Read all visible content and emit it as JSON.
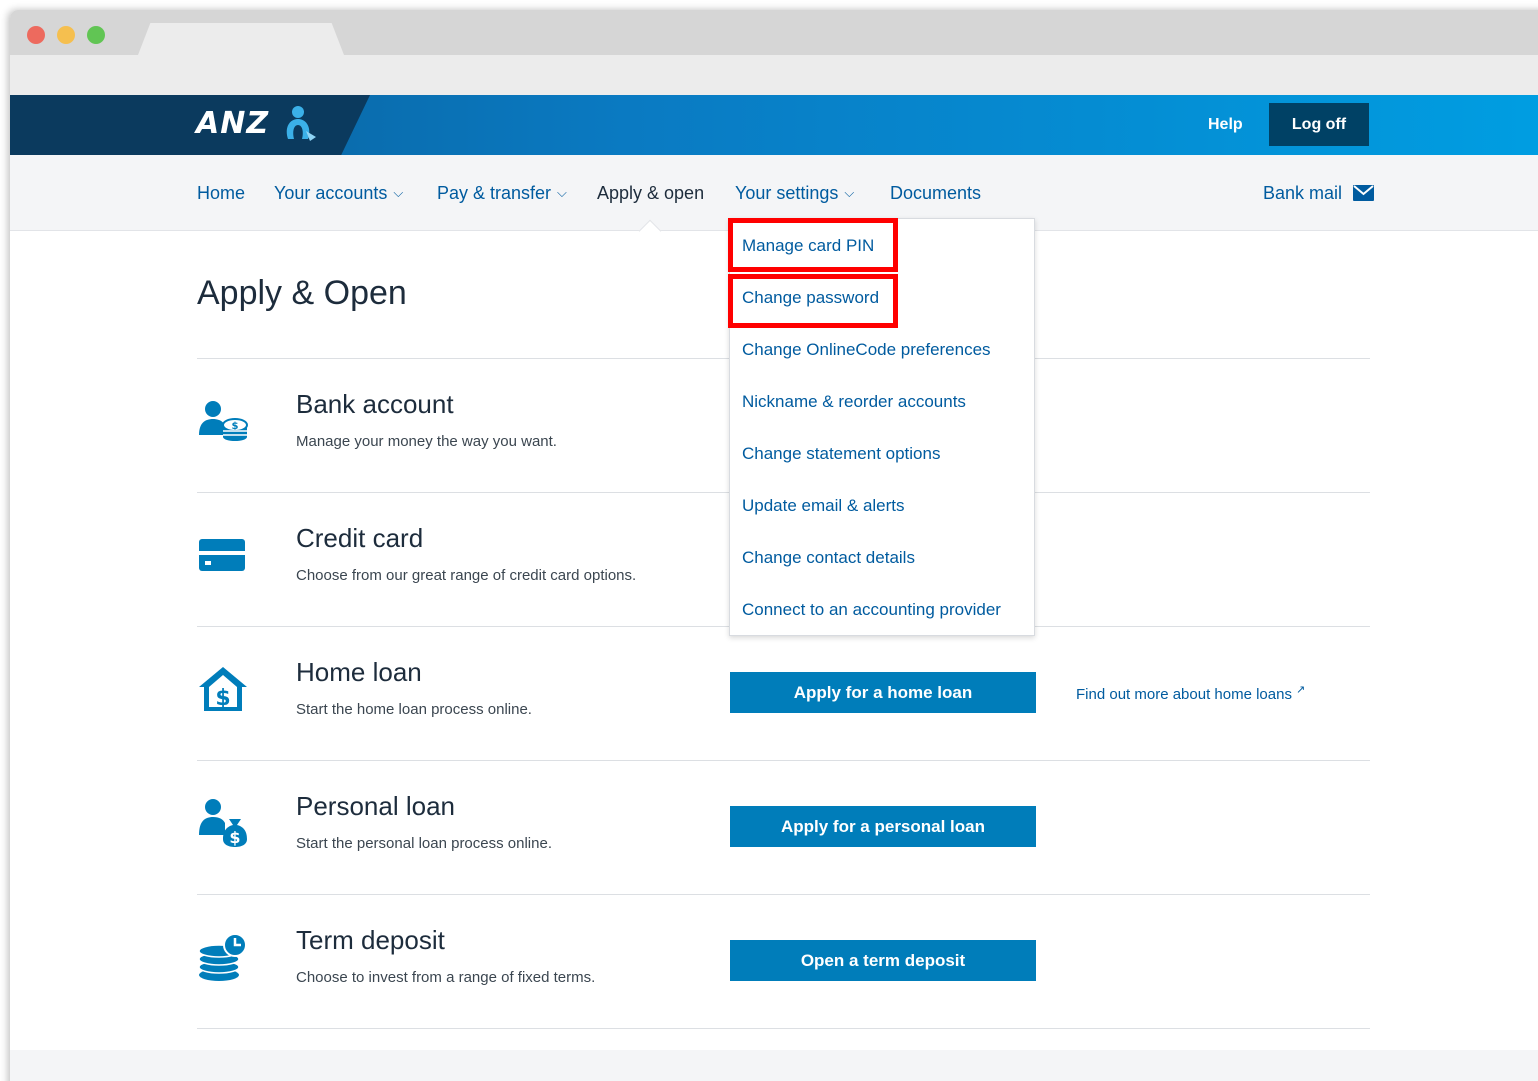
{
  "header": {
    "brand": "ANZ",
    "help_label": "Help",
    "logoff_label": "Log off"
  },
  "nav": {
    "home": "Home",
    "your_accounts": "Your accounts",
    "pay_transfer": "Pay & transfer",
    "apply_open": "Apply & open",
    "your_settings": "Your settings",
    "documents": "Documents",
    "bank_mail": "Bank mail",
    "active": "Apply & open"
  },
  "settings_menu": {
    "items": [
      "Manage card PIN",
      "Change password",
      "Change OnlineCode preferences",
      "Nickname & reorder accounts",
      "Change statement options",
      "Update email & alerts",
      "Change contact details",
      "Connect to an accounting provider"
    ],
    "highlighted": [
      "Manage card PIN",
      "Change password"
    ]
  },
  "main": {
    "title": "Apply & Open",
    "products": [
      {
        "icon": "bank-account-icon",
        "name": "Bank account",
        "description": "Manage your money the way you want."
      },
      {
        "icon": "credit-card-icon",
        "name": "Credit card",
        "description": "Choose from our great range of credit card options."
      },
      {
        "icon": "home-loan-icon",
        "name": "Home loan",
        "description": "Start the home loan process online.",
        "button": "Apply for a home loan",
        "link": "Find out more about home loans"
      },
      {
        "icon": "personal-loan-icon",
        "name": "Personal loan",
        "description": "Start the personal loan process online.",
        "button": "Apply for a personal loan"
      },
      {
        "icon": "term-deposit-icon",
        "name": "Term deposit",
        "description": "Choose to invest from a range of fixed terms.",
        "button": "Open a term deposit"
      }
    ]
  },
  "colors": {
    "brand_dark": "#004165",
    "brand_blue": "#007dba",
    "link_blue": "#005b9f",
    "highlight_red": "#ff0000"
  }
}
